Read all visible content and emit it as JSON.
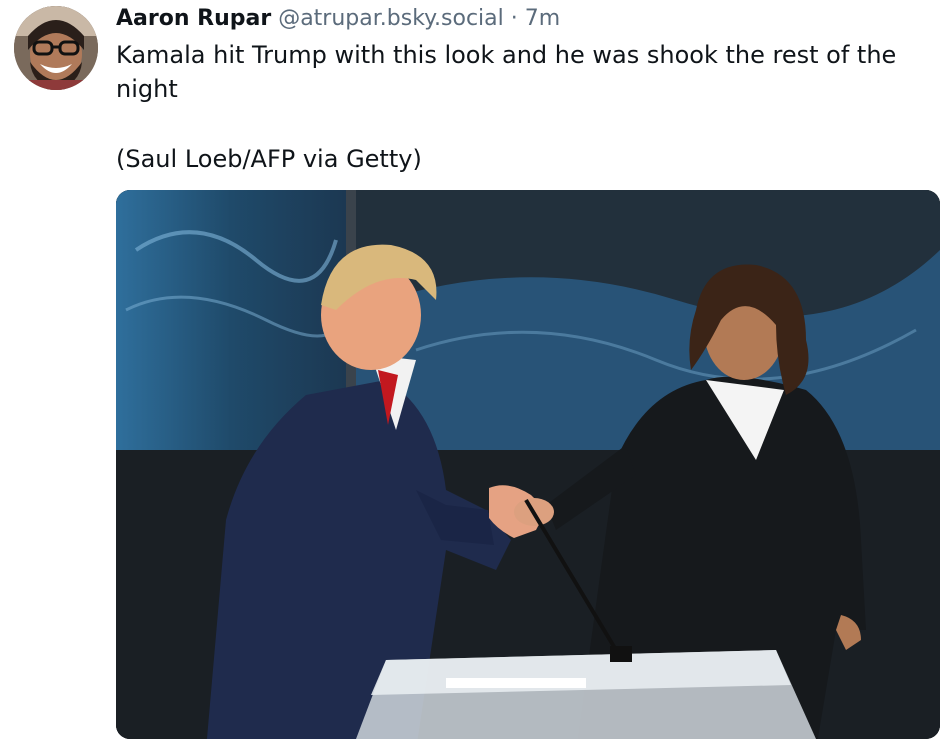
{
  "post": {
    "author_name": "Aaron Rupar",
    "handle": "@atrupar.bsky.social",
    "separator": "·",
    "time": "7m",
    "text_line1": "Kamala hit Trump with this look and he was shook the rest of the night",
    "photo_credit": "(Saul Loeb/AFP via Getty)"
  },
  "media": {
    "icon": "photo"
  },
  "colors": {
    "text": "#0f1419",
    "muted": "#5b6b7b"
  }
}
